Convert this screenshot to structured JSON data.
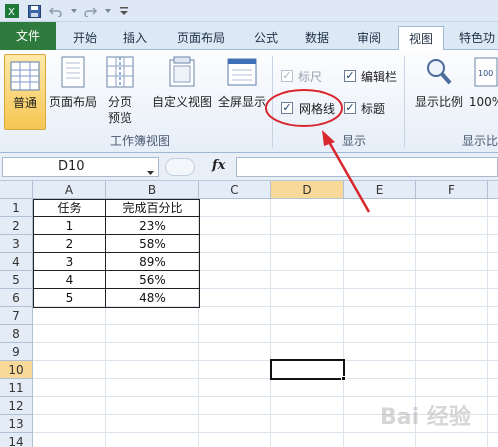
{
  "quick_access": {
    "icons": [
      "save-icon",
      "undo-icon",
      "redo-icon",
      "customize-icon"
    ]
  },
  "tabs": [
    {
      "label": "文件"
    },
    {
      "label": "开始"
    },
    {
      "label": "插入"
    },
    {
      "label": "页面布局"
    },
    {
      "label": "公式"
    },
    {
      "label": "数据"
    },
    {
      "label": "审阅"
    },
    {
      "label": "视图"
    },
    {
      "label": "特色功"
    }
  ],
  "ribbon": {
    "workbook_views": {
      "normal": "普通",
      "page_layout": "页面布局",
      "page_break_1": "分页",
      "page_break_2": "预览",
      "custom_views": "自定义视图",
      "full_screen": "全屏显示",
      "group_label": "工作簿视图"
    },
    "show": {
      "ruler": "标尺",
      "formula_bar": "编辑栏",
      "gridlines": "网格线",
      "headings": "标题",
      "group_label": "显示"
    },
    "zoom": {
      "zoom": "显示比例",
      "hundred": "100%",
      "group_label": "显示比"
    }
  },
  "formula_bar": {
    "name_box": "D10",
    "fx": "fx",
    "value": ""
  },
  "sheet": {
    "columns": [
      "A",
      "B",
      "C",
      "D",
      "E",
      "F"
    ],
    "rows": [
      "1",
      "2",
      "3",
      "4",
      "5",
      "6",
      "7",
      "8",
      "9",
      "10",
      "11",
      "12",
      "13",
      "14"
    ],
    "header": {
      "a": "任务",
      "b": "完成百分比"
    },
    "data": [
      {
        "a": "1",
        "b": "23%"
      },
      {
        "a": "2",
        "b": "58%"
      },
      {
        "a": "3",
        "b": "89%"
      },
      {
        "a": "4",
        "b": "56%"
      },
      {
        "a": "5",
        "b": "48%"
      }
    ],
    "active_cell": "D10"
  },
  "watermark": "Bai 经验"
}
